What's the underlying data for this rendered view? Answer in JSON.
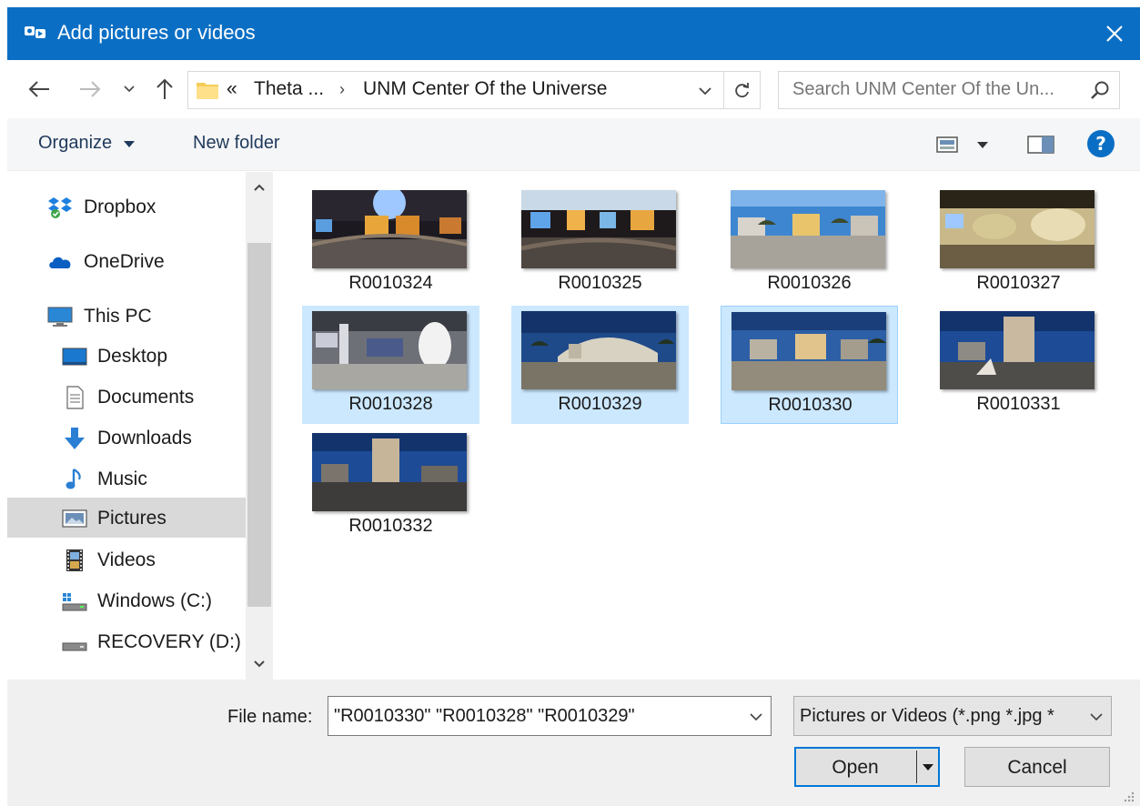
{
  "window": {
    "title": "Add pictures or videos",
    "title_icon": "app-icon",
    "accent_color": "#0a6fc4"
  },
  "address": {
    "overflow": "«",
    "segments": [
      "Theta ...",
      "UNM Center Of the Universe"
    ],
    "separator": "›"
  },
  "search": {
    "placeholder": "Search UNM Center Of the Un..."
  },
  "toolbar": {
    "organize_label": "Organize",
    "new_folder_label": "New folder"
  },
  "nav": {
    "items": [
      {
        "label": "Dropbox",
        "icon": "dropbox-icon"
      },
      {
        "label": "OneDrive",
        "icon": "onedrive-icon"
      },
      {
        "label": "This PC",
        "icon": "computer-icon"
      },
      {
        "label": "Desktop",
        "icon": "desktop-icon"
      },
      {
        "label": "Documents",
        "icon": "documents-icon"
      },
      {
        "label": "Downloads",
        "icon": "downloads-icon"
      },
      {
        "label": "Music",
        "icon": "music-icon"
      },
      {
        "label": "Pictures",
        "icon": "pictures-icon",
        "selected": true
      },
      {
        "label": "Videos",
        "icon": "videos-icon"
      },
      {
        "label": "Windows (C:)",
        "icon": "drive-c-icon"
      },
      {
        "label": "RECOVERY (D:)",
        "icon": "drive-d-icon"
      }
    ]
  },
  "files": [
    {
      "name": "R0010324",
      "selected": false
    },
    {
      "name": "R0010325",
      "selected": false
    },
    {
      "name": "R0010326",
      "selected": false
    },
    {
      "name": "R0010327",
      "selected": false
    },
    {
      "name": "R0010328",
      "selected": true
    },
    {
      "name": "R0010329",
      "selected": true
    },
    {
      "name": "R0010330",
      "selected": true,
      "focused": true
    },
    {
      "name": "R0010331",
      "selected": false
    },
    {
      "name": "R0010332",
      "selected": false
    }
  ],
  "footer": {
    "file_name_label": "File name:",
    "file_name_value": "\"R0010330\" \"R0010328\" \"R0010329\"",
    "file_type_value": "Pictures or Videos (*.png *.jpg *",
    "open_label": "Open",
    "cancel_label": "Cancel"
  }
}
